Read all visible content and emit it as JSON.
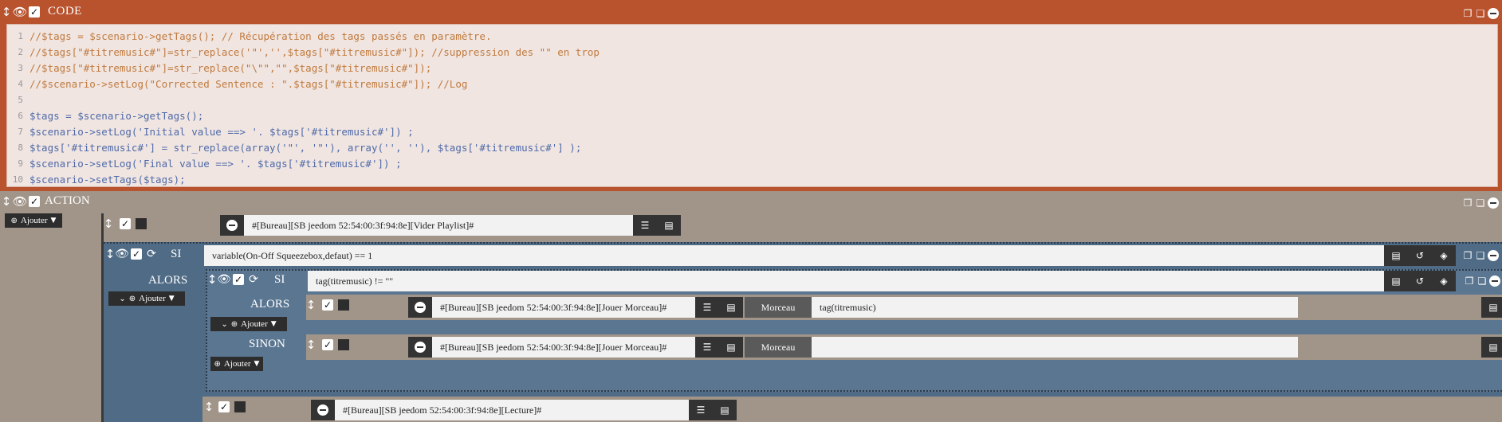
{
  "code_block": {
    "title": "CODE",
    "lines": [
      {
        "num": "1",
        "text": "//$tags = $scenario->getTags(); // Récupération des tags passés en paramètre."
      },
      {
        "num": "2",
        "text": "//$tags[\"#titremusic#\"]=str_replace('\"','',$tags[\"#titremusic#\"]); //suppression des \"\" en trop"
      },
      {
        "num": "3",
        "text": "//$tags[\"#titremusic#\"]=str_replace(\"\\\"\",\"\",$tags[\"#titremusic#\"]);"
      },
      {
        "num": "4",
        "text": "//$scenario->setLog(\"Corrected Sentence : \".$tags[\"#titremusic#\"]); //Log"
      },
      {
        "num": "5",
        "text": ""
      },
      {
        "num": "6",
        "text": "$tags = $scenario->getTags();"
      },
      {
        "num": "7",
        "text": "$scenario->setLog('Initial value ==> '. $tags['#titremusic#']) ;"
      },
      {
        "num": "8",
        "text": "$tags['#titremusic#'] = str_replace(array('\"', '\"'), array('', ''), $tags['#titremusic#'] );"
      },
      {
        "num": "9",
        "text": "$scenario->setLog('Final value ==> '. $tags['#titremusic#']) ;"
      },
      {
        "num": "10",
        "text": "$scenario->setTags($tags);"
      }
    ]
  },
  "action_block": {
    "title": "ACTION",
    "add_label": "Ajouter",
    "first_cmd": "#[Bureau][SB jeedom 52:54:00:3f:94:8e][Vider Playlist]#",
    "if_block": {
      "si_label": "SI",
      "condition": "variable(On-Off Squeezebox,defaut)  == 1",
      "alors_label": "ALORS",
      "add_label": "Ajouter",
      "inner_if": {
        "si_label": "SI",
        "condition": "tag(titremusic) != \"\"",
        "alors_label": "ALORS",
        "alors_add": "Ajouter",
        "alors_cmd": "#[Bureau][SB jeedom 52:54:00:3f:94:8e][Jouer Morceau]#",
        "alors_param_label": "Morceau",
        "alors_param_value": "tag(titremusic)",
        "sinon_label": "SINON",
        "sinon_add": "Ajouter",
        "sinon_cmd": "#[Bureau][SB jeedom 52:54:00:3f:94:8e][Jouer Morceau]#",
        "sinon_param_label": "Morceau",
        "sinon_param_value": ""
      }
    },
    "last_cmd": "#[Bureau][SB jeedom 52:54:00:3f:94:8e][Lecture]#"
  },
  "colors": {
    "code_header": "#b9532e",
    "code_bg": "#f0e5e1",
    "action_bg": "#a19589",
    "if_bg": "#4f6b85",
    "inner_if_bg": "#5b7691"
  }
}
